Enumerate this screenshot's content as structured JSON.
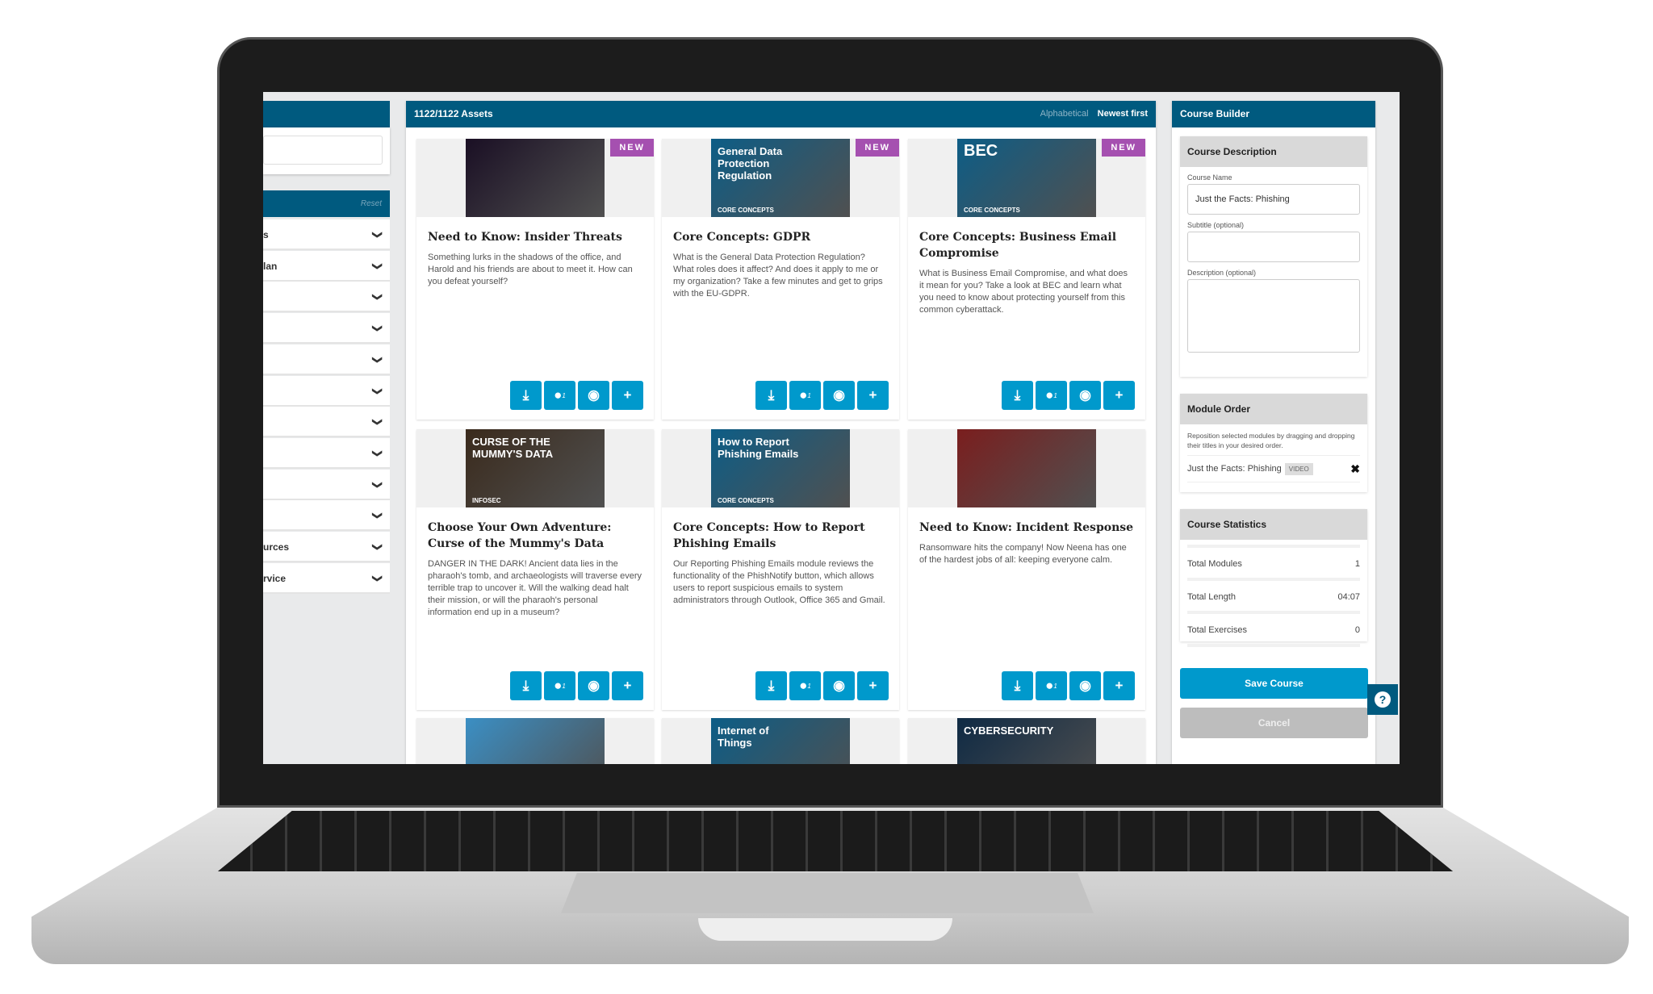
{
  "sidebar": {
    "reset": "Reset",
    "filters": [
      "s",
      "lan",
      "",
      "",
      "",
      "",
      "",
      "",
      "",
      "",
      "urces",
      "rvice"
    ]
  },
  "main": {
    "asset_count": "1122/1122 Assets",
    "sort_options": [
      "Alphabetical",
      "Newest first"
    ],
    "active_sort": "Newest first",
    "badge": "NEW",
    "actions": [
      {
        "icon": "download-icon",
        "glyph": "⤓"
      },
      {
        "icon": "globe-languages-icon",
        "glyph": "●",
        "count": "1"
      },
      {
        "icon": "eye-preview-icon",
        "glyph": "◉"
      },
      {
        "icon": "plus-add-icon",
        "glyph": "+"
      }
    ],
    "cards": [
      {
        "title": "Need to Know: Insider Threats",
        "desc": "Something lurks in the shadows of the office, and Harold and his friends are about to meet it. How can you defeat yourself?",
        "new": true,
        "img_text": "",
        "img_color": "#1a0f24"
      },
      {
        "title": "Core Concepts: GDPR",
        "desc": "What is the General Data Protection Regulation? What roles does it affect? And does it apply to me or my organization? Take a few minutes and get to grips with the EU-GDPR.",
        "new": true,
        "img_text": "General Data Protection Regulation",
        "img_sub": "CORE CONCEPTS",
        "img_color": "#0d5d86"
      },
      {
        "title": "Core Concepts: Business Email Compromise",
        "desc": "What is Business Email Compromise, and what does it mean for you? Take a look at BEC and learn what you need to know about protecting yourself from this common cyberattack.",
        "new": true,
        "img_text": "BEC",
        "img_sub": "CORE CONCEPTS",
        "img_color": "#0d5d86"
      },
      {
        "title": "Choose Your Own Adventure: Curse of the Mummy's Data",
        "desc": "DANGER IN THE DARK! Ancient data lies in the pharaoh's tomb, and archaeologists will traverse every terrible trap to uncover it. Will the walking dead halt their mission, or will the pharaoh's personal information end up in a museum?",
        "new": false,
        "img_text": "CURSE OF THE MUMMY'S DATA",
        "img_sub": "INFOSEC",
        "img_color": "#3a2a1c"
      },
      {
        "title": "Core Concepts: How to Report Phishing Emails",
        "desc": "Our Reporting Phishing Emails module reviews the functionality of the PhishNotify button, which allows users to report suspicious emails to system administrators through Outlook, Office 365 and Gmail.",
        "new": false,
        "img_text": "How to Report Phishing Emails",
        "img_sub": "CORE CONCEPTS",
        "img_color": "#0d5d86"
      },
      {
        "title": "Need to Know: Incident Response",
        "desc": "Ransomware hits the company! Now Neena has one of the hardest jobs of all: keeping everyone calm.",
        "new": false,
        "img_text": "",
        "img_color": "#7a1e1e"
      },
      {
        "title": "",
        "desc": "",
        "new": false,
        "img_text": "",
        "img_color": "#3b8fc4"
      },
      {
        "title": "",
        "desc": "",
        "new": false,
        "img_text": "Internet of Things",
        "img_color": "#0d5d86"
      },
      {
        "title": "",
        "desc": "",
        "new": false,
        "img_text": "CYBERSECURITY",
        "img_color": "#0f2a44"
      }
    ]
  },
  "builder": {
    "title": "Course Builder",
    "description": {
      "heading": "Course Description",
      "name_label": "Course Name",
      "name_value": "Just the Facts: Phishing",
      "subtitle_label": "Subtitle (optional)",
      "desc_label": "Description (optional)"
    },
    "module_order": {
      "heading": "Module Order",
      "hint": "Reposition selected modules by dragging and dropping their titles in your desired order.",
      "modules": [
        {
          "name": "Just the Facts: Phishing",
          "type": "VIDEO"
        }
      ]
    },
    "stats": {
      "heading": "Course Statistics",
      "rows": [
        {
          "label": "Total Modules",
          "value": "1"
        },
        {
          "label": "Total Length",
          "value": "04:07"
        },
        {
          "label": "Total Exercises",
          "value": "0"
        }
      ]
    },
    "save": "Save Course",
    "cancel": "Cancel",
    "help": "?"
  },
  "colors": {
    "header": "#005a7f",
    "accent": "#0099cc",
    "badge": "#a550b0"
  }
}
